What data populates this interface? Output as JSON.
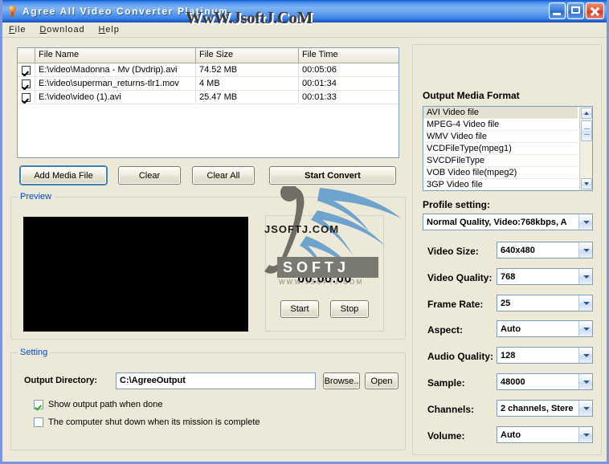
{
  "window": {
    "title": "Agree All Video Converter Platinum",
    "icon": "flame-icon",
    "minimize_label": "",
    "maximize_label": "",
    "close_label": ""
  },
  "menu": {
    "items": [
      {
        "label": "File",
        "accel": "F"
      },
      {
        "label": "Download",
        "accel": "D"
      },
      {
        "label": "Help",
        "accel": "H"
      }
    ]
  },
  "file_list": {
    "columns": [
      "",
      "File Name",
      "File Size",
      "File Time"
    ],
    "rows": [
      {
        "checked": true,
        "name": "E:\\video\\Madonna - Mv (Dvdrip).avi",
        "size": "74.52 MB",
        "time": "00:05:06"
      },
      {
        "checked": true,
        "name": "E:\\video\\superman_returns-tlr1.mov",
        "size": "4 MB",
        "time": "00:01:34"
      },
      {
        "checked": true,
        "name": "E:\\video\\video (1).avi",
        "size": "25.47 MB",
        "time": "00:01:33"
      }
    ]
  },
  "buttons": {
    "add_media_file": "Add Media File",
    "clear": "Clear",
    "clear_all": "Clear All",
    "start_convert": "Start Convert"
  },
  "preview": {
    "group_title": "Preview",
    "timer": "00:00:00",
    "start": "Start",
    "stop": "Stop"
  },
  "setting": {
    "group_title": "Setting",
    "output_directory_label": "Output Directory:",
    "output_directory_value": "C:\\AgreeOutput",
    "browse": "Browse..",
    "open": "Open",
    "show_output_path_label": "Show output path when done",
    "show_output_path_checked": true,
    "shutdown_label": "The computer shut down when its mission is complete",
    "shutdown_checked": false
  },
  "output_media_format": {
    "title": "Output Media Format",
    "items": [
      "AVI Video file",
      "MPEG-4 Video file",
      "WMV Video file",
      "VCDFileType(mpeg1)",
      "SVCDFileType",
      "VOB Video file(mpeg2)",
      "3GP Video file"
    ],
    "selected_index": 0
  },
  "profile": {
    "label": "Profile setting:",
    "value": "Normal Quality, Video:768kbps, A"
  },
  "fields": [
    {
      "label": "Video Size:",
      "value": "640x480"
    },
    {
      "label": "Video Quality:",
      "value": "768"
    },
    {
      "label": "Frame Rate:",
      "value": "25"
    },
    {
      "label": "Aspect:",
      "value": "Auto"
    },
    {
      "label": "Audio Quality:",
      "value": "128"
    },
    {
      "label": "Sample:",
      "value": "48000"
    },
    {
      "label": "Channels:",
      "value": "2 channels, Stere"
    },
    {
      "label": "Volume:",
      "value": "Auto"
    }
  ],
  "watermarks": {
    "top": "WwW.JsoftJ.CoM",
    "center_text": "JSOFTJ.COM",
    "logo_text": "SOFTJ",
    "logo_url": "WWW.JSOFTJ.COM"
  },
  "colors": {
    "window_frame": "#7a96df",
    "face": "#ece9d8",
    "group_title": "#0046d5",
    "close_button": "#cf3d1f"
  }
}
